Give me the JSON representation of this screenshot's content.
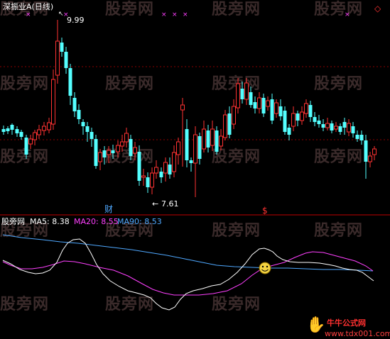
{
  "title": "深振业A(日线)",
  "price_high_label": "9.99",
  "price_low_label": "7.61",
  "markers": {
    "finance": "财",
    "dollar": "$"
  },
  "indicator": {
    "name": "股旁网",
    "ma5_label": "MA5: 8.38",
    "ma20_label": "MA20: 8.55",
    "ma90_label": "MA90: 8.53"
  },
  "watermark_text": "股旁网",
  "footer_logo": "牛牛公式网",
  "footer_url": "www.tdx001.com",
  "colors": {
    "up": "#FF3232",
    "down": "#54FFFF",
    "ma5": "#FFFFFF",
    "ma20": "#FF40FF",
    "ma90": "#4FA8FF",
    "grid": "#8B0000",
    "watermark": "#3A2A2A"
  }
}
